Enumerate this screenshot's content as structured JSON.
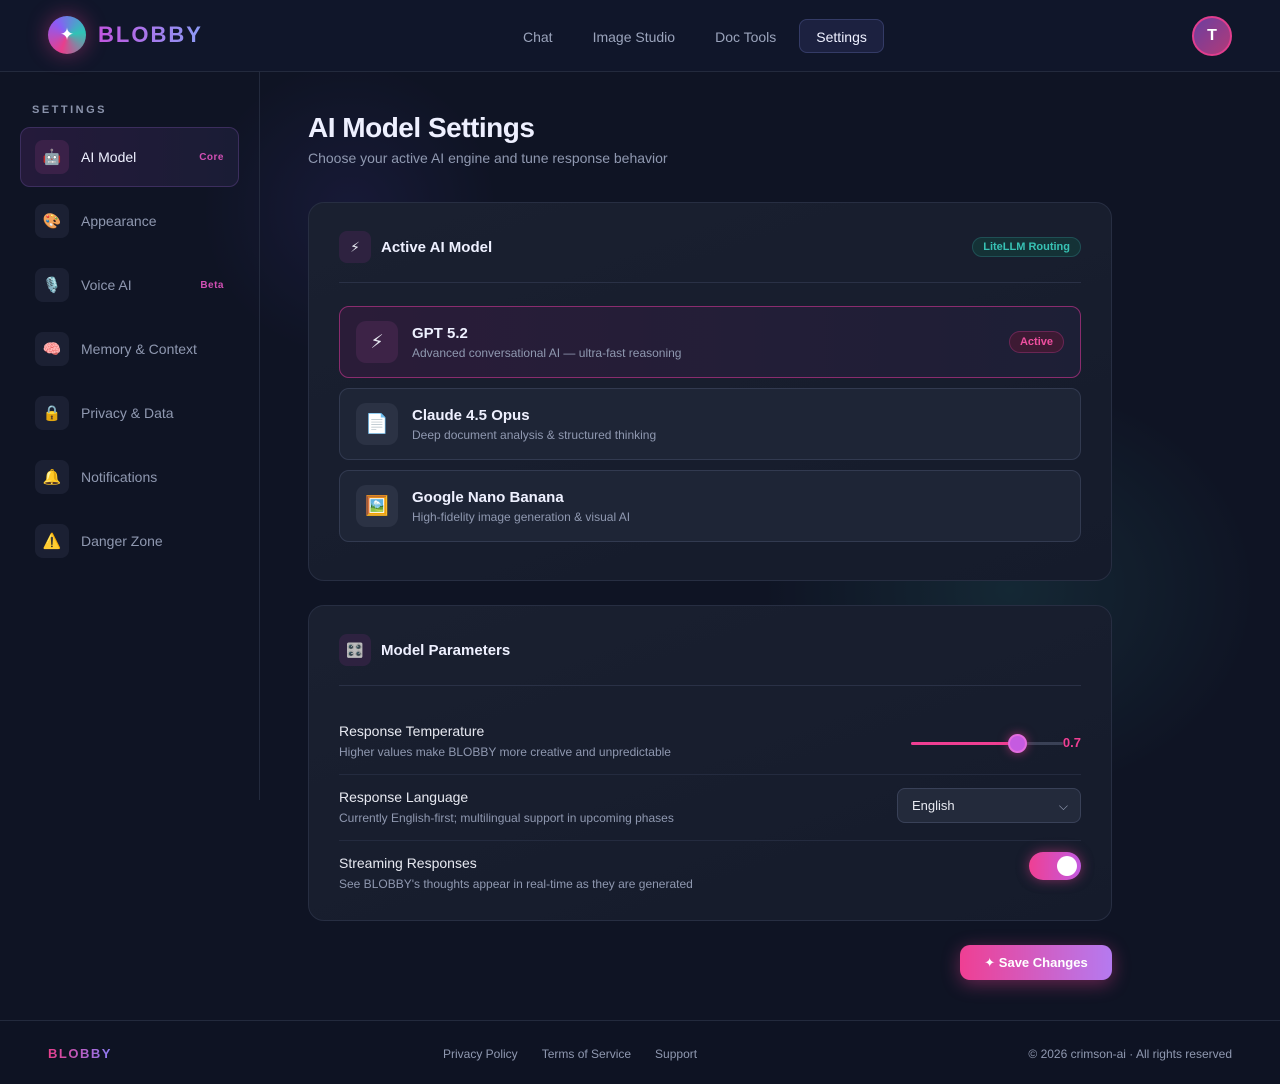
{
  "app": {
    "brand": "BLOBBY",
    "logo_glyph": "✦",
    "avatar_initial": "T"
  },
  "nav": {
    "items": [
      {
        "label": "Chat"
      },
      {
        "label": "Image Studio"
      },
      {
        "label": "Doc Tools"
      },
      {
        "label": "Settings",
        "active": true
      }
    ]
  },
  "sidebar": {
    "heading": "SETTINGS",
    "items": [
      {
        "label": "AI Model",
        "icon": "🤖",
        "icon_name": "robot-icon",
        "badge": "Core",
        "active": true
      },
      {
        "label": "Appearance",
        "icon": "🎨",
        "icon_name": "palette-icon",
        "badge": ""
      },
      {
        "label": "Voice AI",
        "icon": "🎙️",
        "icon_name": "microphone-icon",
        "badge": "Beta"
      },
      {
        "label": "Memory & Context",
        "icon": "🧠",
        "icon_name": "brain-icon",
        "badge": ""
      },
      {
        "label": "Privacy & Data",
        "icon": "🔒",
        "icon_name": "lock-icon",
        "badge": ""
      },
      {
        "label": "Notifications",
        "icon": "🔔",
        "icon_name": "bell-icon",
        "badge": ""
      },
      {
        "label": "Danger Zone",
        "icon": "⚠️",
        "icon_name": "warning-icon",
        "badge": ""
      }
    ]
  },
  "page": {
    "title": "AI Model Settings",
    "subtitle": "Choose your active AI engine and tune response behavior"
  },
  "active_model_card": {
    "icon": "⚡",
    "title": "Active AI Model",
    "badge": "LiteLLM Routing",
    "models": [
      {
        "name": "GPT 5.2",
        "desc": "Advanced conversational AI — ultra-fast reasoning",
        "icon": "⚡",
        "icon_name": "lightning-icon",
        "badge": "Active",
        "active": true
      },
      {
        "name": "Claude 4.5 Opus",
        "desc": "Deep document analysis & structured thinking",
        "icon": "📄",
        "icon_name": "document-icon",
        "badge": "",
        "active": false
      },
      {
        "name": "Google Nano Banana",
        "desc": "High-fidelity image generation & visual AI",
        "icon": "🖼️",
        "icon_name": "picture-icon",
        "badge": "",
        "active": false
      }
    ]
  },
  "params_card": {
    "icon": "🎛️",
    "title": "Model Parameters",
    "temperature": {
      "label": "Response Temperature",
      "desc": "Higher values make BLOBBY more creative and unpredictable",
      "value": 0.7,
      "value_text": "0.7"
    },
    "language": {
      "label": "Response Language",
      "desc": "Currently English-first; multilingual support in upcoming phases",
      "selected": "English"
    },
    "streaming": {
      "label": "Streaming Responses",
      "desc": "See BLOBBY's thoughts appear in real-time as they are generated",
      "enabled": true
    }
  },
  "actions": {
    "save_label": "✦ Save Changes"
  },
  "footer": {
    "brand": "BLOBBY",
    "links": [
      "Privacy Policy",
      "Terms of Service",
      "Support"
    ],
    "copyright": "© 2026 crimson-ai · All rights reserved"
  },
  "colors": {
    "accent_pink": "#ef3f93",
    "accent_purple": "#b57af0",
    "teal": "#37c2b4",
    "background": "#0f1424"
  }
}
